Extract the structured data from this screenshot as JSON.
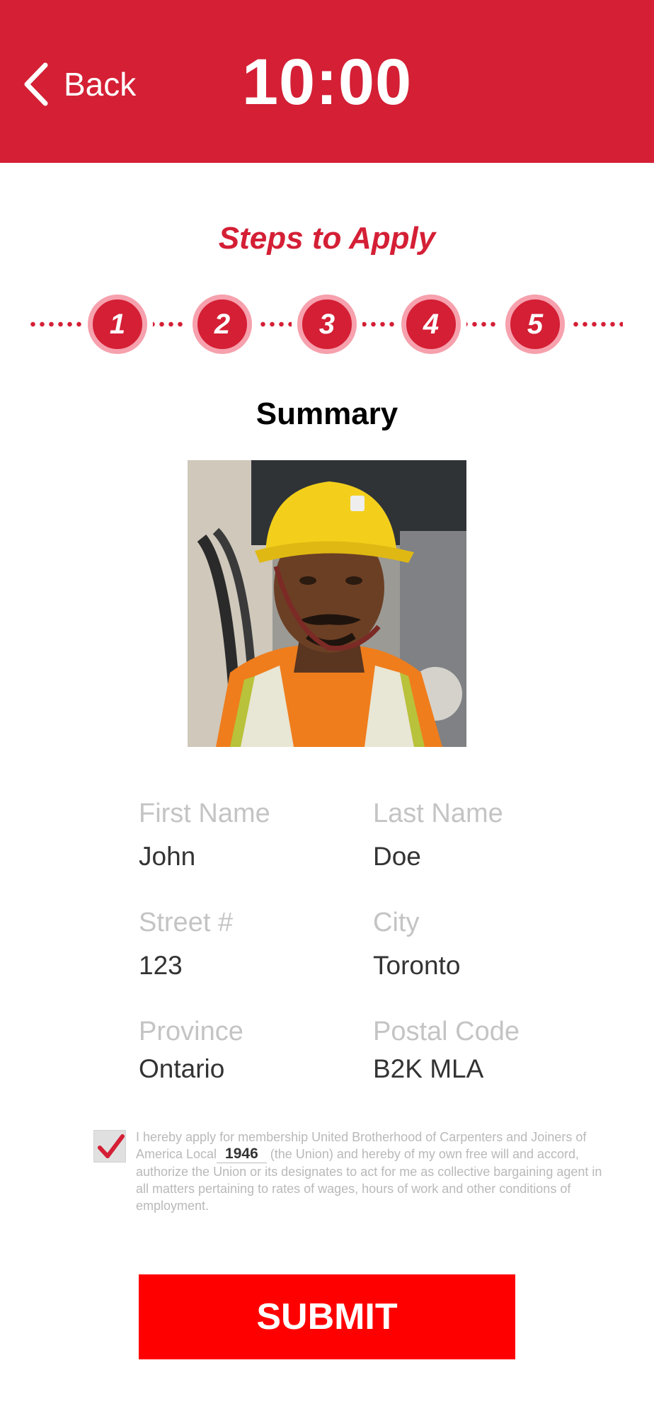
{
  "header": {
    "back_label": "Back",
    "time": "10:00",
    "color": "#d41f35"
  },
  "steps": {
    "title": "Steps to Apply",
    "items": [
      "1",
      "2",
      "3",
      "4",
      "5"
    ]
  },
  "summary": {
    "title": "Summary",
    "photo_icon": "profile-photo"
  },
  "fields": {
    "first_name": {
      "label": "First Name",
      "value": "John"
    },
    "last_name": {
      "label": "Last Name",
      "value": "Doe"
    },
    "street": {
      "label": "Street #",
      "value": "123"
    },
    "city": {
      "label": "City",
      "value": "Toronto"
    },
    "province": {
      "label": "Province",
      "value": "Ontario"
    },
    "postal_code": {
      "label": "Postal Code",
      "value": "B2K MLA"
    }
  },
  "consent": {
    "checked": true,
    "text_before": "I hereby apply for membership United Brotherhood of Carpenters and Joiners of America Local",
    "local_number": "1946",
    "text_after": "(the Union) and hereby of my own free will and accord, authorize the Union or its designates to act for me as collective bargaining agent in all matters pertaining to rates of wages, hours of work and other conditions of employment."
  },
  "submit_label": "SUBMIT"
}
